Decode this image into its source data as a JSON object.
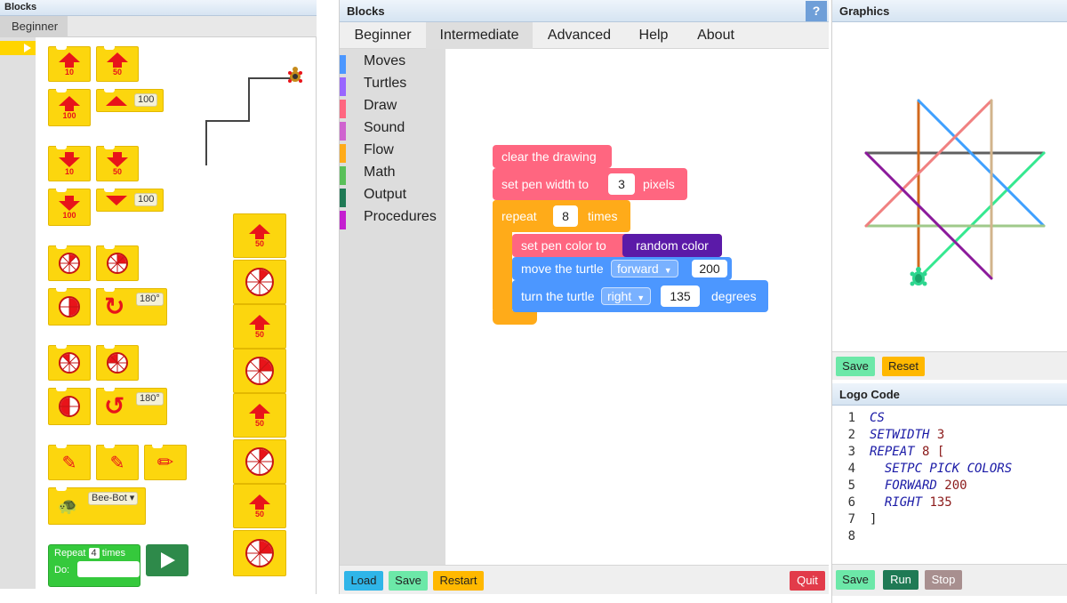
{
  "left_panel": {
    "title": "Blocks",
    "tab": "Beginner",
    "forward_labels": [
      "10",
      "50",
      "100",
      "100"
    ],
    "back_labels": [
      "10",
      "50",
      "100",
      "100"
    ],
    "column_labels": [
      "50",
      "50",
      "50",
      "50"
    ],
    "turn_right_angle": "180°",
    "turn_left_angle": "180°",
    "turtle_select": "Bee-Bot",
    "repeat": {
      "label_pre": "Repeat",
      "count": "4",
      "label_post": "times",
      "do": "Do:"
    }
  },
  "blocks_panel": {
    "title": "Blocks",
    "help": "?",
    "tabs": [
      "Beginner",
      "Intermediate",
      "Advanced",
      "Help",
      "About"
    ],
    "active_tab": "Intermediate",
    "categories": [
      {
        "label": "Moves",
        "color": "#4c97ff"
      },
      {
        "label": "Turtles",
        "color": "#9966ff"
      },
      {
        "label": "Draw",
        "color": "#ff6680"
      },
      {
        "label": "Sound",
        "color": "#cf63cf"
      },
      {
        "label": "Flow",
        "color": "#ffab19"
      },
      {
        "label": "Math",
        "color": "#59c059"
      },
      {
        "label": "Output",
        "color": "#1f7a55"
      },
      {
        "label": "Procedures",
        "color": "#c41ed0"
      }
    ],
    "program": {
      "clear": "clear the drawing",
      "pen_width": {
        "label": "set pen width to",
        "value": "3",
        "unit": "pixels"
      },
      "repeat": {
        "label": "repeat",
        "value": "8",
        "unit": "times"
      },
      "pen_color": {
        "label": "set pen color to",
        "value": "random color"
      },
      "move": {
        "label": "move the turtle",
        "dir": "forward",
        "value": "200"
      },
      "turn": {
        "label": "turn the turtle",
        "dir": "right",
        "value": "135",
        "unit": "degrees"
      }
    },
    "buttons": {
      "load": "Load",
      "save": "Save",
      "restart": "Restart",
      "quit": "Quit"
    }
  },
  "graphics_panel": {
    "title": "Graphics",
    "buttons": {
      "save": "Save",
      "reset": "Reset"
    }
  },
  "code_panel": {
    "title": "Logo Code",
    "lines": [
      {
        "n": "1",
        "kw": "CS",
        "arg": ""
      },
      {
        "n": "2",
        "kw": "SETWIDTH",
        "arg": "3"
      },
      {
        "n": "3",
        "kw": "REPEAT",
        "arg": "8 ["
      },
      {
        "n": "4",
        "kw": "  SETPC PICK COLORS",
        "arg": ""
      },
      {
        "n": "5",
        "kw": "  FORWARD",
        "arg": "200"
      },
      {
        "n": "6",
        "kw": "  RIGHT",
        "arg": "135"
      },
      {
        "n": "7",
        "kw": "]",
        "arg": ""
      },
      {
        "n": "8",
        "kw": "",
        "arg": ""
      }
    ],
    "buttons": {
      "save": "Save",
      "run": "Run",
      "stop": "Stop"
    }
  },
  "colors": {
    "draw": "#ff6680",
    "moves": "#4c97ff",
    "flow": "#ffab19",
    "purple": "#5b1aa8",
    "load": "#2fb5e8",
    "save": "#6ce8a8",
    "restart": "#ffb800",
    "quit": "#e23b4a",
    "run": "#1f7a55",
    "stop": "#a88f8f"
  }
}
